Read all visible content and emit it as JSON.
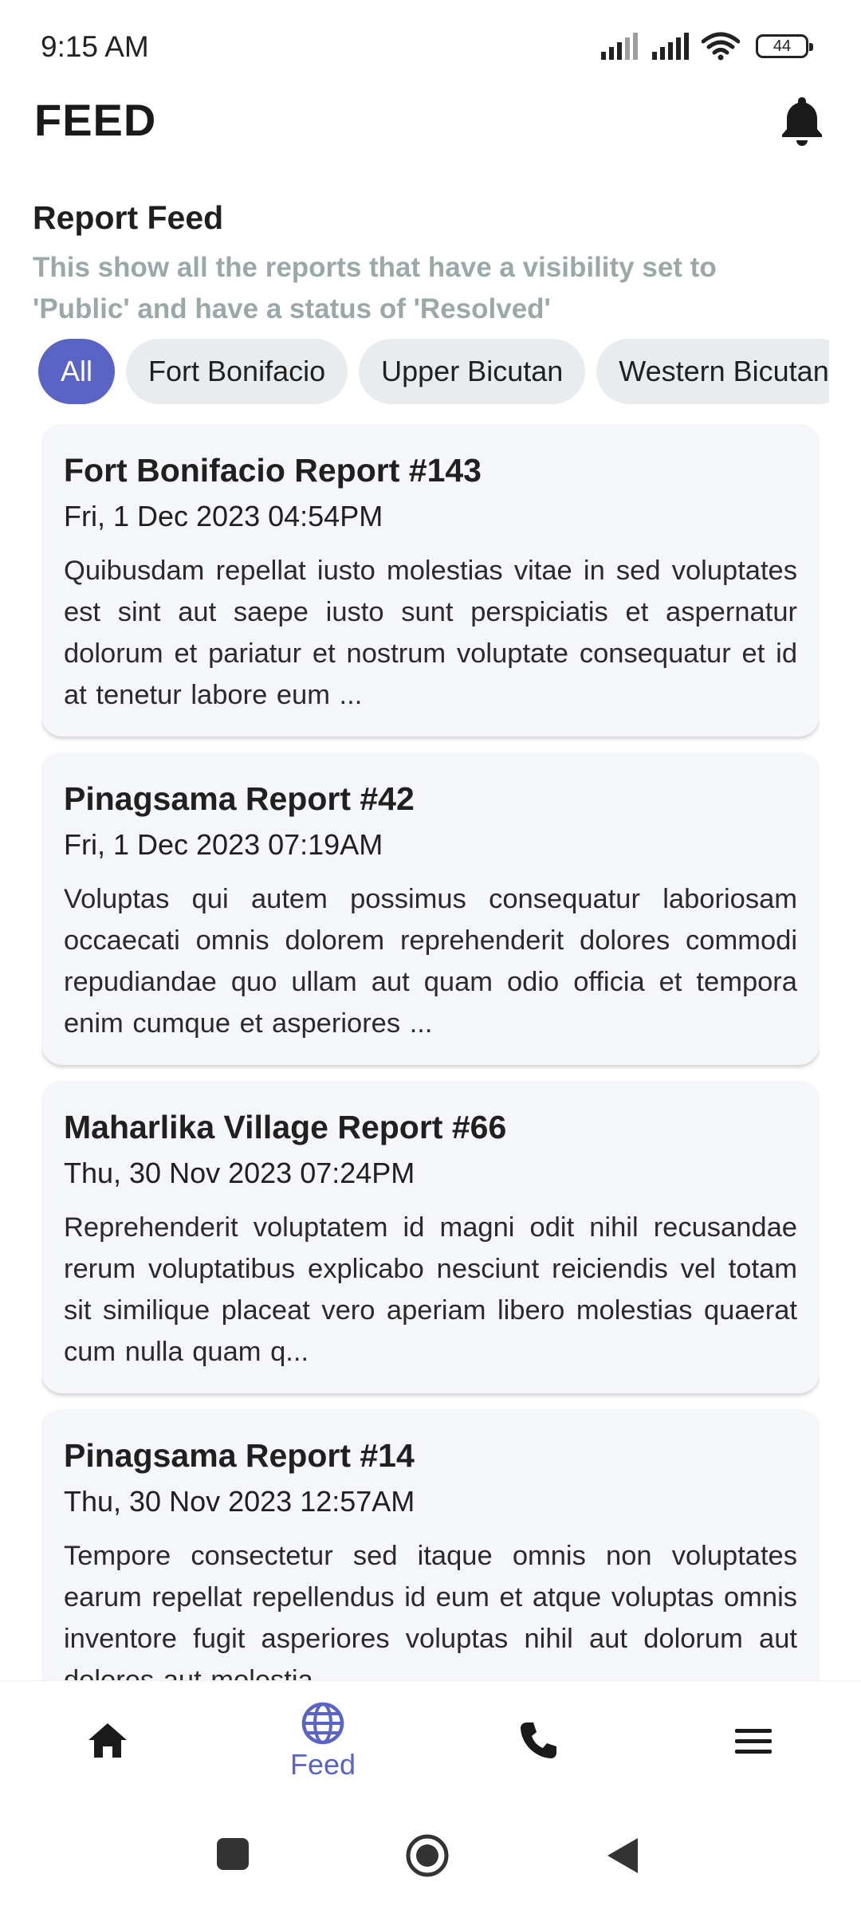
{
  "status_bar": {
    "time": "9:15 AM",
    "battery": "44",
    "icons": [
      "signal-icon",
      "signal-icon",
      "wifi-icon",
      "battery-icon"
    ]
  },
  "header": {
    "title": "FEED",
    "notification_icon": "bell-icon"
  },
  "section": {
    "title": "Report Feed",
    "subtitle": "This show all the reports that have a visibility set to 'Public' and have a status of 'Resolved'"
  },
  "filters": {
    "selected": "All",
    "chips": [
      {
        "label": "All"
      },
      {
        "label": "Fort Bonifacio"
      },
      {
        "label": "Upper Bicutan"
      },
      {
        "label": "Western Bicutan"
      }
    ]
  },
  "reports": [
    {
      "title": "Fort Bonifacio Report #143",
      "date": "Fri, 1 Dec 2023 04:54PM",
      "body": "Quibusdam repellat iusto molestias vitae in sed voluptates est sint aut saepe iusto sunt perspiciatis et aspernatur dolorum et pariatur et nostrum voluptate consequatur et id at tenetur labore eum ..."
    },
    {
      "title": "Pinagsama Report #42",
      "date": "Fri, 1 Dec 2023 07:19AM",
      "body": "Voluptas qui autem possimus consequatur laboriosam occaecati omnis dolorem reprehenderit dolores commodi repudiandae quo ullam aut quam odio officia et tempora enim cumque et asperiores ..."
    },
    {
      "title": "Maharlika Village Report #66",
      "date": "Thu, 30 Nov 2023 07:24PM",
      "body": "Reprehenderit voluptatem id magni odit nihil recusandae rerum voluptatibus explicabo nesciunt reiciendis vel totam sit similique placeat vero aperiam libero molestias quaerat cum nulla quam q..."
    },
    {
      "title": "Pinagsama Report #14",
      "date": "Thu, 30 Nov 2023 12:57AM",
      "body": "Tempore consectetur sed itaque omnis non voluptates earum repellat repellendus id eum et atque voluptas omnis inventore fugit asperiores voluptas nihil aut dolorum aut dolores aut molestia..."
    }
  ],
  "bottom_nav": {
    "items": [
      {
        "icon": "home-icon",
        "label": ""
      },
      {
        "icon": "globe-icon",
        "label": "Feed",
        "active": true
      },
      {
        "icon": "phone-icon",
        "label": ""
      },
      {
        "icon": "menu-icon",
        "label": ""
      }
    ]
  },
  "system_nav": {
    "buttons": [
      "recents-button",
      "home-button",
      "back-button"
    ]
  },
  "colors": {
    "accent": "#5a64c4",
    "subtitle": "#9aa9a8",
    "card_bg": "#f5f6f9",
    "chip_bg": "#e9ecef"
  }
}
